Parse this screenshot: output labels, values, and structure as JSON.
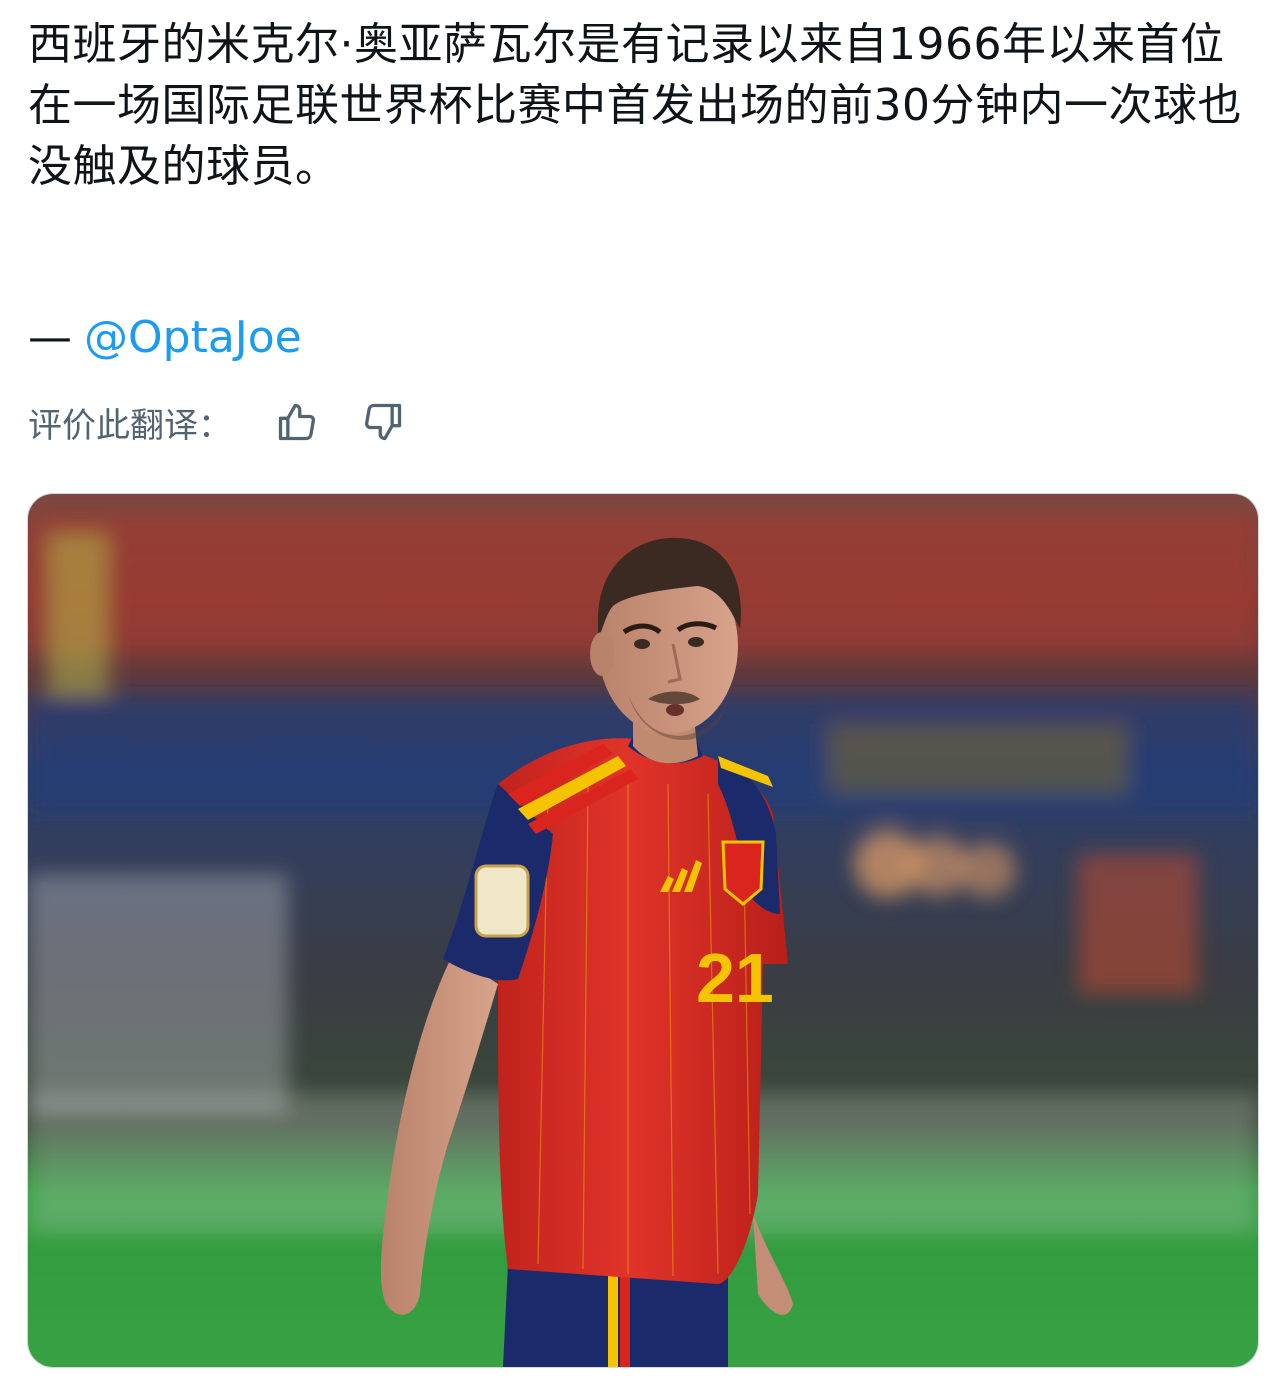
{
  "tweet": {
    "text": "西班牙的米克尔·奥亚萨瓦尔是有记录以来自1966年以来首位在一场国际足联世界杯比赛中首发出场的前30分钟内一次球也没触及的球员。",
    "attribution_dash": "—",
    "attribution_handle": "@OptaJoe"
  },
  "translation_rating": {
    "label": "评价此翻译：",
    "icons": [
      "thumbs-up-icon",
      "thumbs-down-icon"
    ]
  },
  "media": {
    "jersey_number": "21"
  },
  "colors": {
    "link": "#1d9bf0",
    "secondary_text": "#536471",
    "jersey_red": "#d9251d",
    "jersey_yellow": "#f5c400",
    "jersey_navy": "#1b2a6b"
  }
}
